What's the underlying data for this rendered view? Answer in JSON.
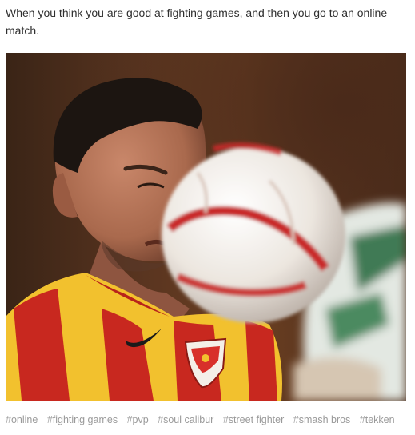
{
  "post": {
    "caption": "When you think you are good at fighting games, and then you go to an online match."
  },
  "photo": {
    "subject": "soccer player struck in the face by a ball",
    "colors": {
      "jersey_yellow": "#f2c12e",
      "jersey_red": "#c8281f",
      "ball_white": "#f1ece6",
      "ball_red": "#c92a2a",
      "skin": "#b07052",
      "hair": "#1c1511",
      "background": "#5a3520"
    }
  },
  "tags": [
    "#online",
    "#fighting games",
    "#pvp",
    "#soul calibur",
    "#street fighter",
    "#smash bros",
    "#tekken"
  ]
}
